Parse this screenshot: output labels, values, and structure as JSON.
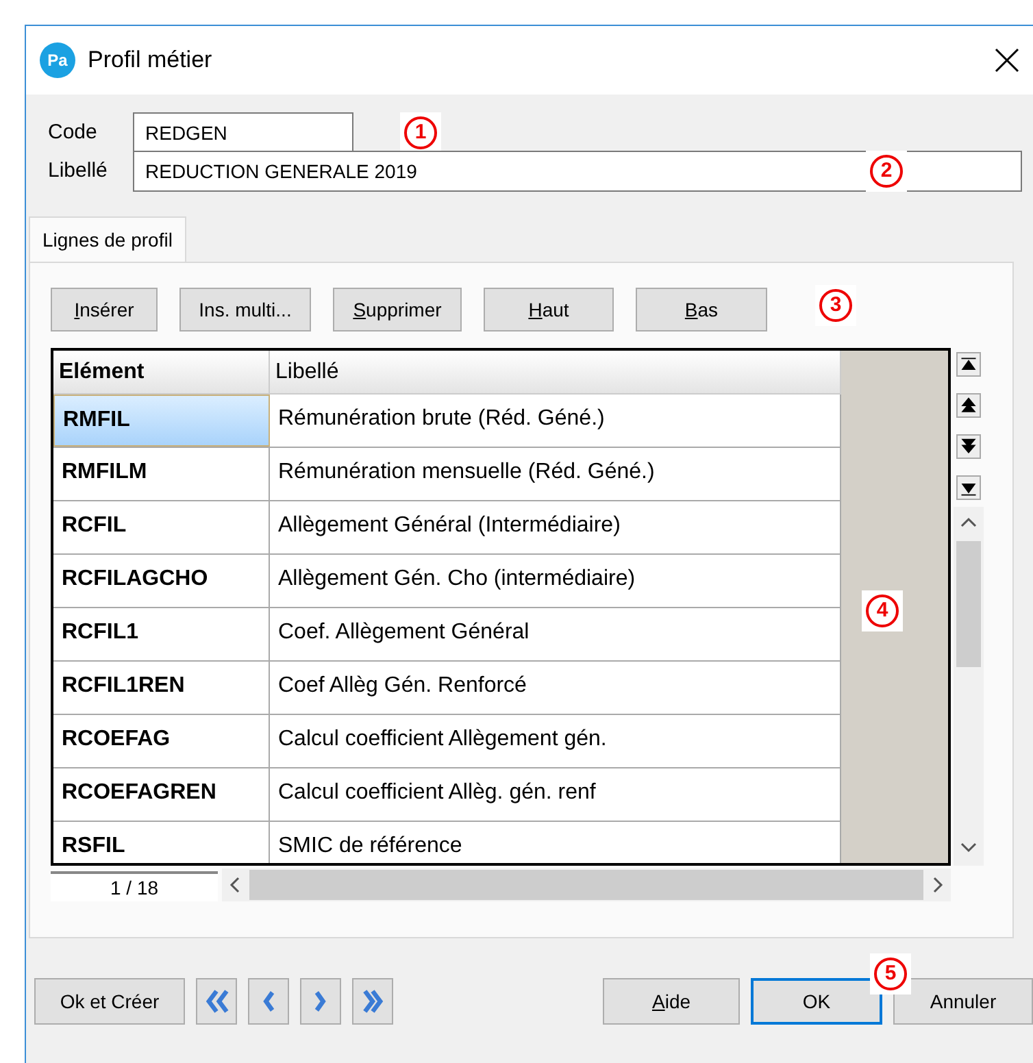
{
  "window": {
    "title": "Profil métier",
    "icon_text": "Pa"
  },
  "fields": [
    {
      "label": "Code",
      "value": "REDGEN",
      "annotation": "1"
    },
    {
      "label": "Libellé",
      "value": "REDUCTION GENERALE 2019",
      "annotation": "2"
    }
  ],
  "tabs": [
    {
      "label": "Lignes de profil",
      "selected": true
    }
  ],
  "toolbar": {
    "annotation": "3",
    "buttons": [
      {
        "key": "I",
        "rest": "nsérer"
      },
      {
        "rest": "Ins. multi..."
      },
      {
        "key": "S",
        "rest": "upprimer"
      },
      {
        "key": "H",
        "rest": "aut"
      },
      {
        "key": "B",
        "rest": "as"
      }
    ]
  },
  "table": {
    "annotation": "4",
    "columns": [
      "Elément",
      "Libellé"
    ],
    "rows": [
      {
        "element": "RMFIL",
        "libelle": "Rémunération brute (Réd. Géné.)",
        "selected": true
      },
      {
        "element": "RMFILM",
        "libelle": "Rémunération mensuelle (Réd. Géné.)",
        "selected": false
      },
      {
        "element": "RCFIL",
        "libelle": "Allègement Général (Intermédiaire)",
        "selected": false
      },
      {
        "element": "RCFILAGCHO",
        "libelle": "Allègement Gén. Cho (intermédiaire)",
        "selected": false
      },
      {
        "element": "RCFIL1",
        "libelle": "Coef.  Allègement Général",
        "selected": false
      },
      {
        "element": "RCFIL1REN",
        "libelle": "Coef Allèg Gén. Renforcé",
        "selected": false
      },
      {
        "element": "RCOEFAG",
        "libelle": "Calcul coefficient Allègement gén.",
        "selected": false
      },
      {
        "element": "RCOEFAGREN",
        "libelle": "Calcul coefficient Allèg. gén. renf",
        "selected": false
      },
      {
        "element": "RSFIL",
        "libelle": "SMIC de référence",
        "selected": false
      }
    ],
    "pager": "1 / 18"
  },
  "footer": {
    "annotation": "5",
    "left_button": "Ok et Créer",
    "buttons": [
      {
        "key": "A",
        "rest": "ide",
        "default": false
      },
      {
        "rest": "OK",
        "default": true
      },
      {
        "rest": "Annuler",
        "default": false
      }
    ]
  }
}
